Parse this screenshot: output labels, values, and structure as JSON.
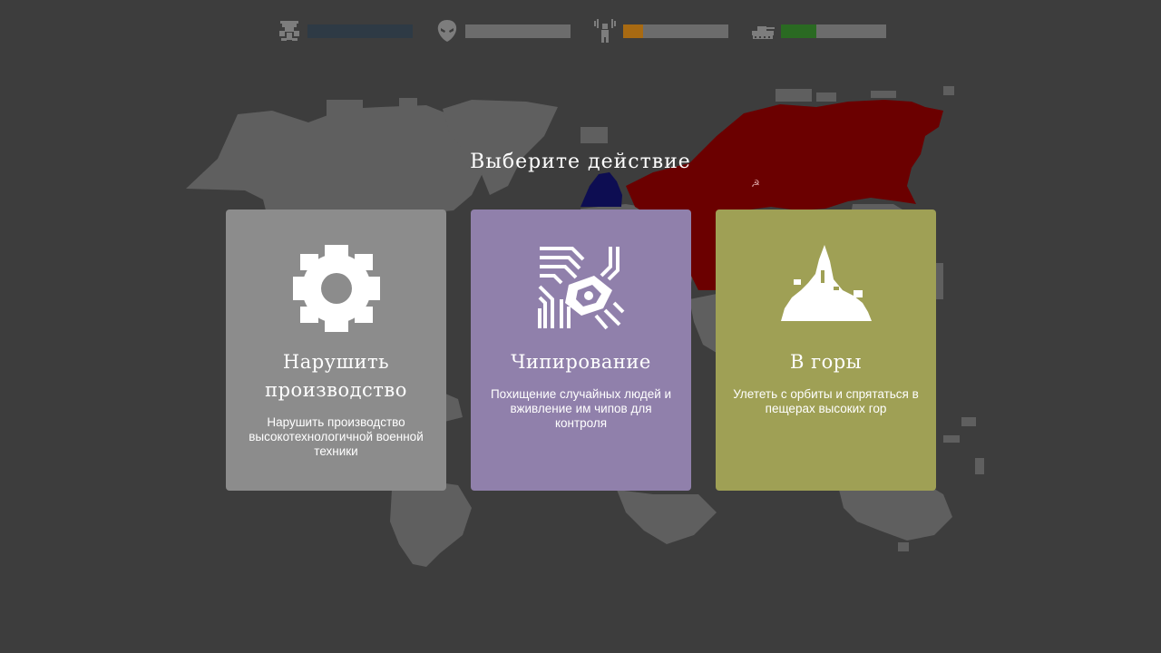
{
  "hud": [
    {
      "icon": "alien-crest-icon",
      "fill": 0,
      "fill_color": "#2e3a45",
      "track_color": "#2e3a45"
    },
    {
      "icon": "alien-head-icon",
      "fill": 0,
      "fill_color": "#6c6c6c",
      "track_color": "#6c6c6c"
    },
    {
      "icon": "human-radar-icon",
      "fill": 0.19,
      "fill_color": "#a86a12",
      "track_color": "#6c6c6c"
    },
    {
      "icon": "tank-icon",
      "fill": 0.34,
      "fill_color": "#2a6a22",
      "track_color": "#6c6c6c"
    }
  ],
  "title": "Выберите действие",
  "cards": [
    {
      "title": "Нарушить производство",
      "description": "Нарушить производство высокотехнологичной военной техники",
      "color": "#8c8c8c",
      "icon": "gear-icon"
    },
    {
      "title": "Чипирование",
      "description": "Похищение случайных людей и вживление им чипов для контроля",
      "color": "#9080ab",
      "icon": "microchip-icon"
    },
    {
      "title": "В горы",
      "description": "Улететь с орбиты и спрятаться в пещерах высоких гор",
      "color": "#9fa055",
      "icon": "mountain-icon"
    }
  ],
  "map_colors": {
    "land": "#5f5f5f",
    "russia": "#6b0000",
    "scandinavia": "#0d0d52",
    "hammer_sickle": "#d9a0a0"
  }
}
